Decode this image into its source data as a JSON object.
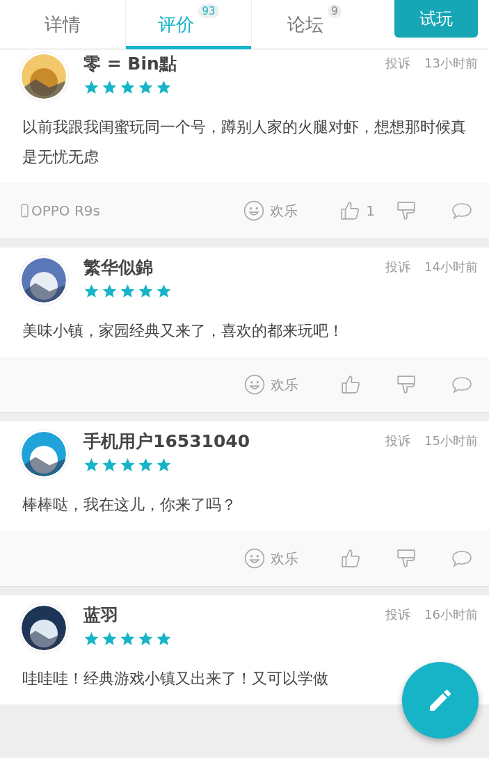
{
  "tabs": [
    {
      "label": "详情",
      "selected": false
    },
    {
      "label": "评价",
      "badge": "93",
      "selected": true
    },
    {
      "label": "论坛",
      "badge": "9",
      "selected": false
    }
  ],
  "try_button": "试玩",
  "reviews": [
    {
      "name": "零 = Bin點",
      "stars": 5,
      "report": "投诉",
      "time": "13小时前",
      "text": "以前我跟我闺蜜玩同一个号，蹲别人家的火腿对虾，想想那时候真是无忧无虑",
      "device": "OPPO R9s",
      "mood": "欢乐",
      "likes": "1"
    },
    {
      "name": "繁华似錦",
      "stars": 5,
      "report": "投诉",
      "time": "14小时前",
      "text": "美味小镇，家园经典又来了，喜欢的都来玩吧！",
      "mood": "欢乐"
    },
    {
      "name": "手机用户16531040",
      "stars": 5,
      "report": "投诉",
      "time": "15小时前",
      "text": "棒棒哒，我在这儿，你来了吗？",
      "mood": "欢乐"
    },
    {
      "name": "蓝羽",
      "stars": 5,
      "report": "投诉",
      "time": "16小时前",
      "text": "哇哇哇！经典游戏小镇又出来了！又可以学做"
    }
  ]
}
